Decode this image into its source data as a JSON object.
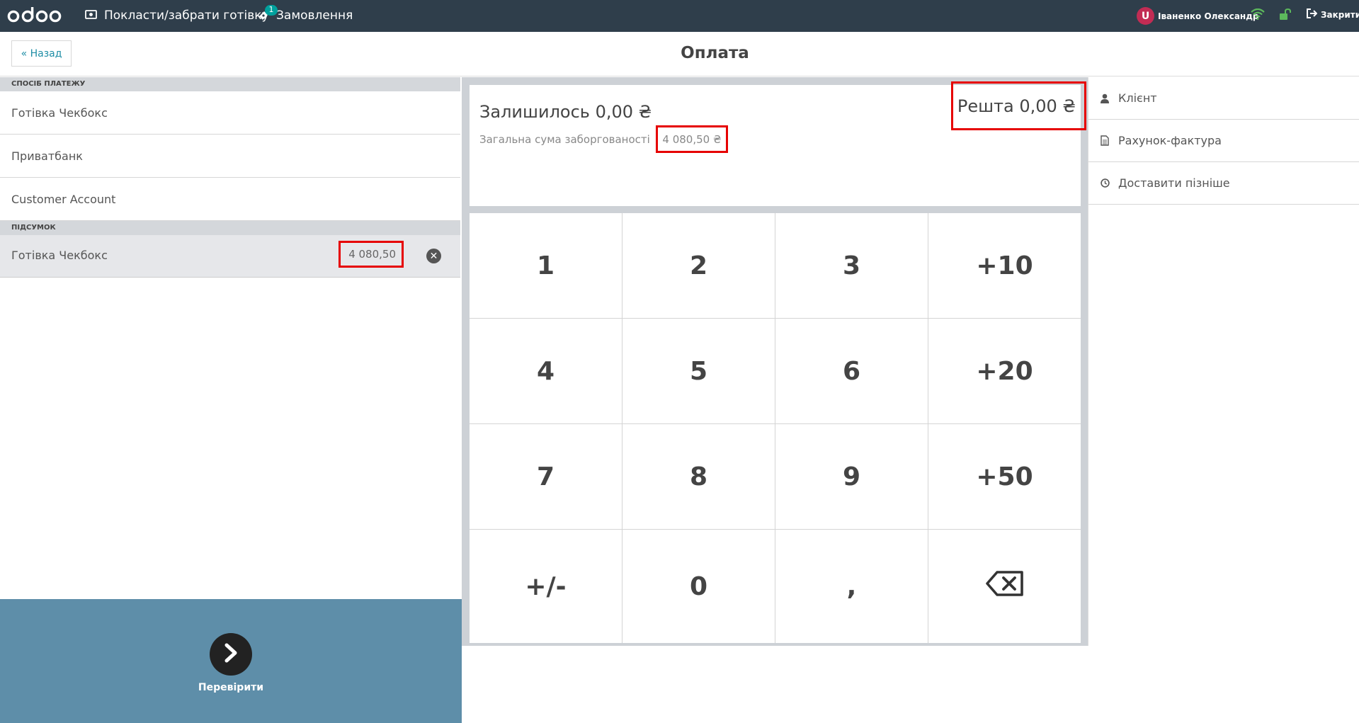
{
  "topbar": {
    "logo": "odoo",
    "cash_label": "Покласти/забрати готівку",
    "orders_label": "Замовлення",
    "orders_count": "1",
    "user_initial": "U",
    "user_name": "Іваненко Олександр",
    "close_label": "Закрити"
  },
  "header": {
    "back_label": "« Назад",
    "title": "Оплата"
  },
  "payment_methods": {
    "section_title": "СПОСІБ ПЛАТЕЖУ",
    "items": [
      {
        "label": "Готівка Чекбокс"
      },
      {
        "label": "Приватбанк"
      },
      {
        "label": "Customer Account"
      }
    ]
  },
  "summary": {
    "section_title": "ПІДСУМОК",
    "lines": [
      {
        "method": "Готівка Чекбокс",
        "amount": "4 080,50"
      }
    ]
  },
  "validate": {
    "label": "Перевірити"
  },
  "status": {
    "remaining": "Залишилось 0,00 ₴",
    "debt_label": "Загальна сума заборгованості",
    "debt_amount": "4 080,50 ₴",
    "change": "Решта 0,00 ₴"
  },
  "numpad": {
    "keys": [
      "1",
      "2",
      "3",
      "+10",
      "4",
      "5",
      "6",
      "+20",
      "7",
      "8",
      "9",
      "+50",
      "+/-",
      "0",
      ",",
      "⌫"
    ]
  },
  "options": {
    "items": [
      {
        "label": "Клієнт",
        "icon": "user-icon"
      },
      {
        "label": "Рахунок-фактура",
        "icon": "document-icon"
      },
      {
        "label": "Доставити пізніше",
        "icon": "clock-icon"
      }
    ]
  },
  "colors": {
    "topbar": "#2f3e4b",
    "validate_panel": "#5e8ea9",
    "highlight": "#e60000",
    "badge": "#00a09d"
  }
}
